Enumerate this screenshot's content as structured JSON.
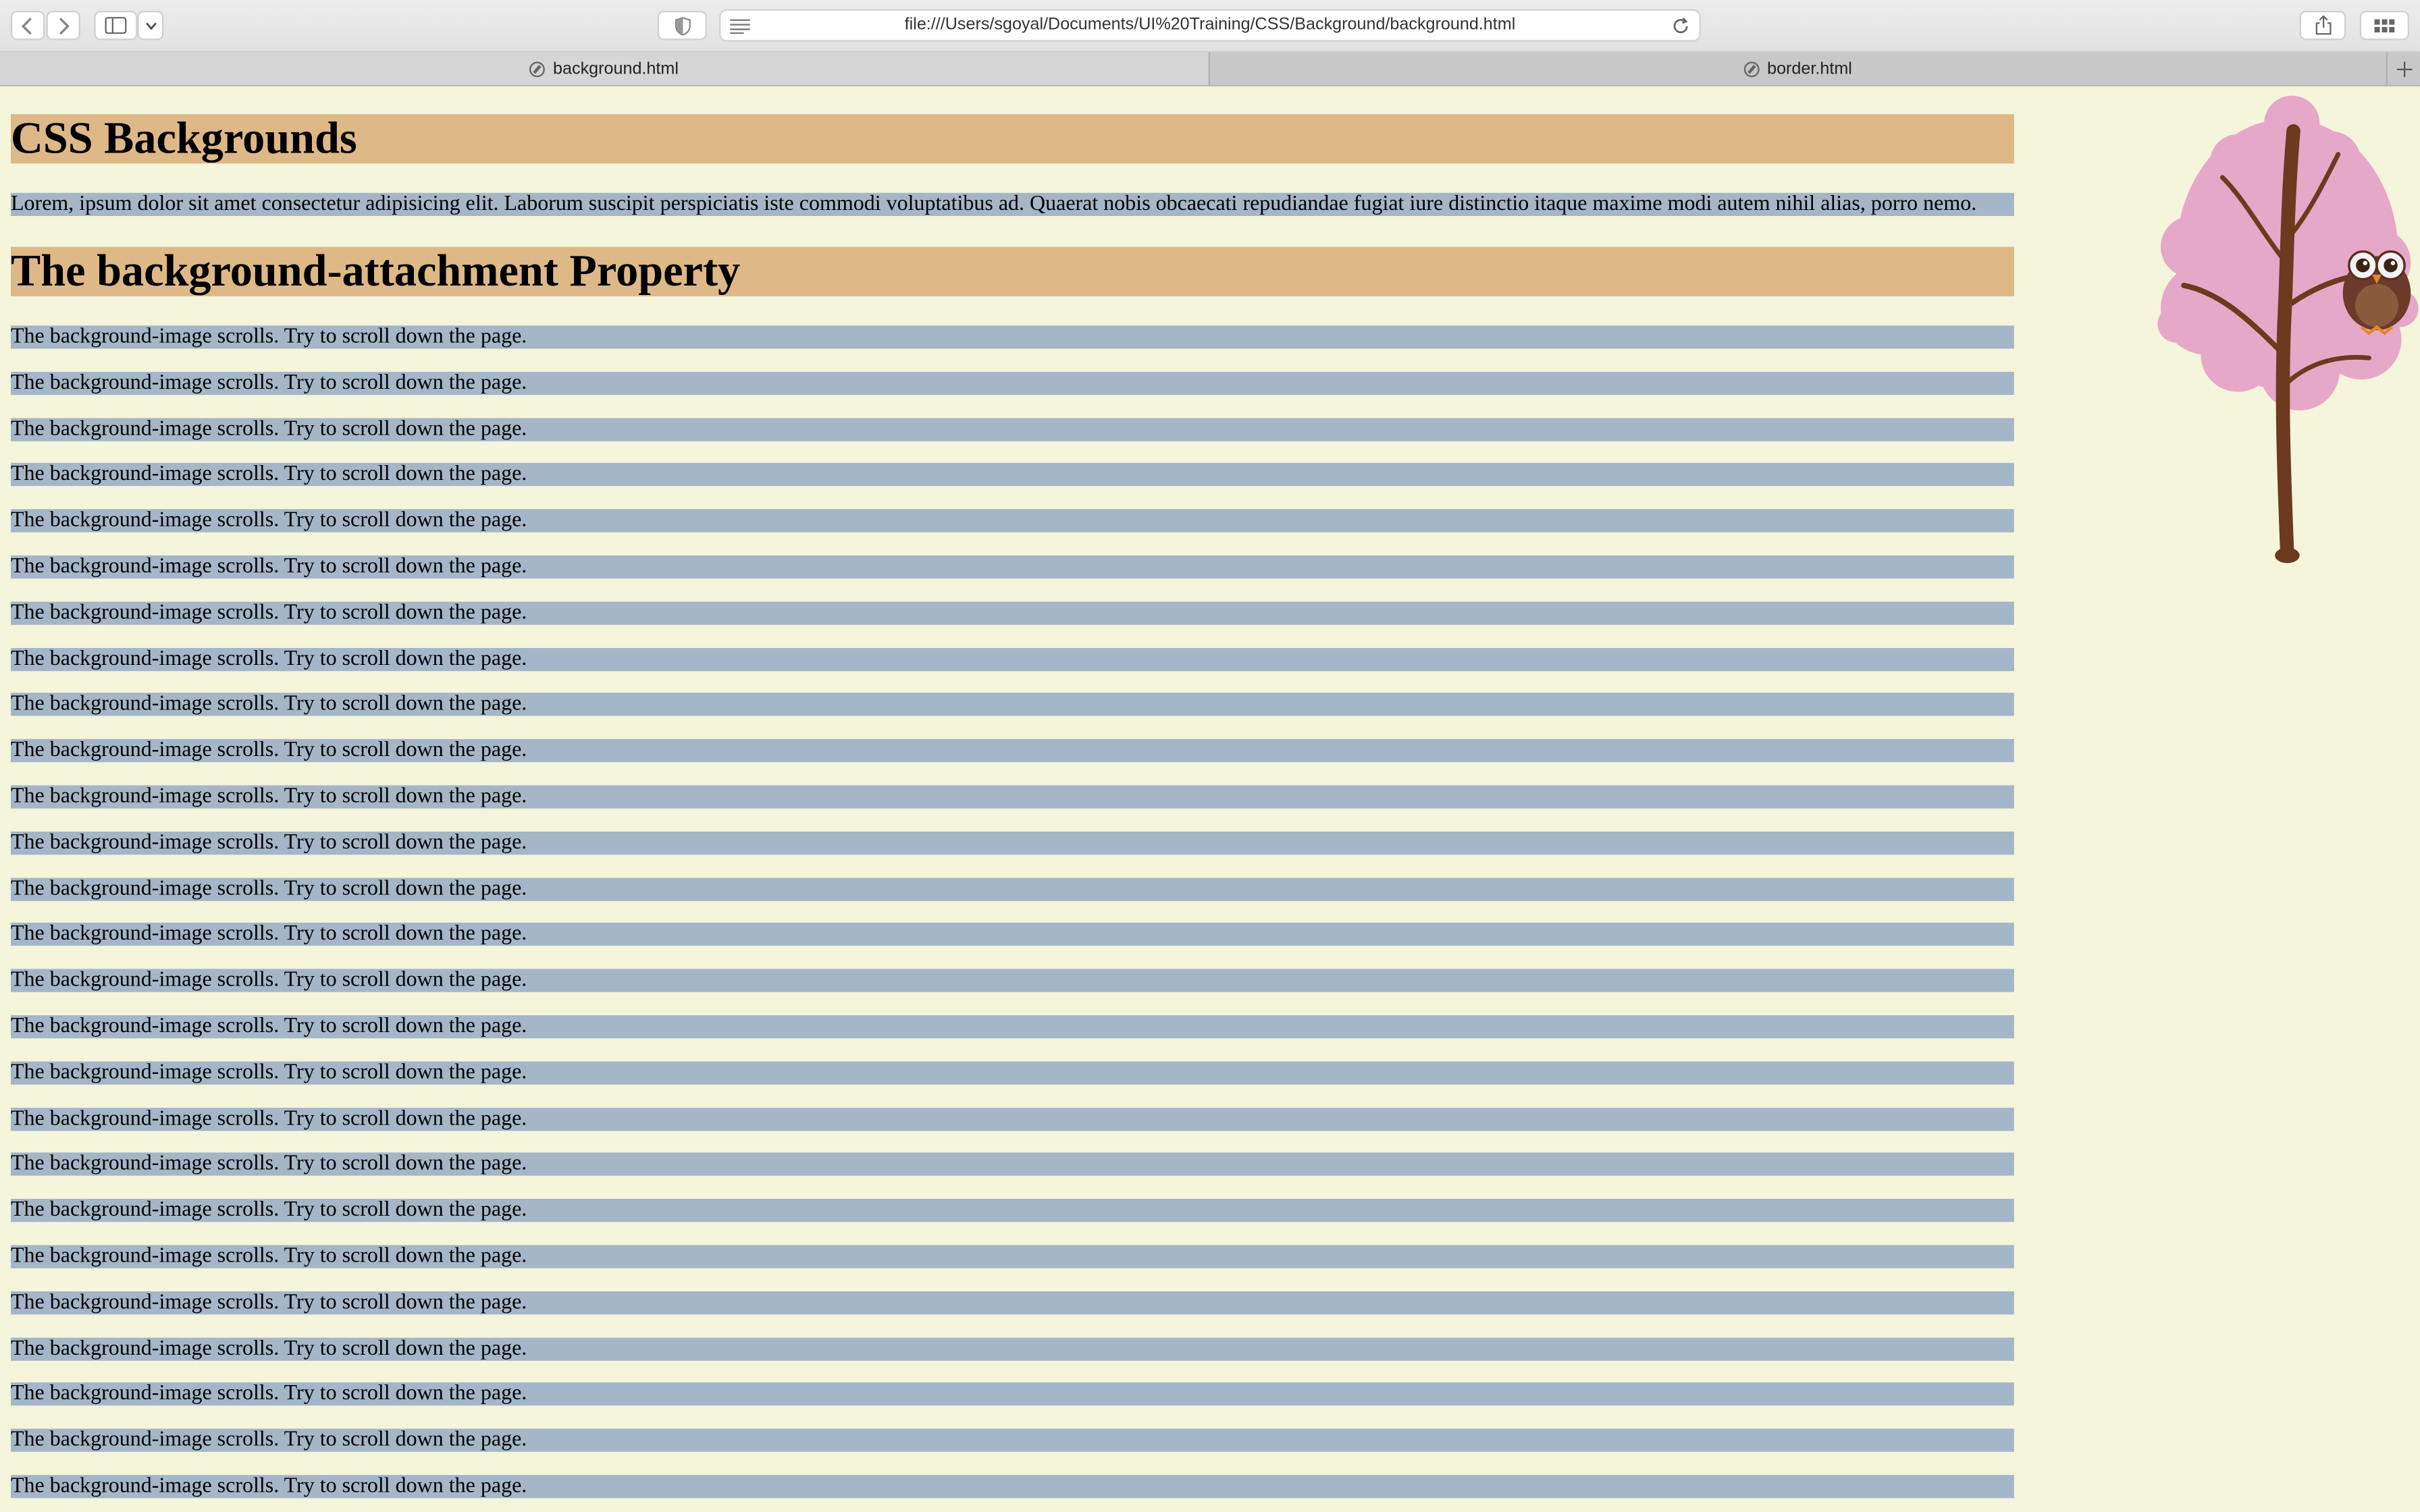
{
  "browser": {
    "url": "file:///Users/sgoyal/Documents/UI%20Training/CSS/Background/background.html",
    "tabs": [
      {
        "label": "background.html",
        "active": true
      },
      {
        "label": "border.html",
        "active": false
      }
    ]
  },
  "page": {
    "heading1": "CSS Backgrounds",
    "intro": "Lorem, ipsum dolor sit amet consectetur adipisicing elit. Laborum suscipit perspiciatis iste commodi voluptatibus ad. Quaerat nobis obcaecati repudiandae fugiat iure distinctio itaque maxime modi autem nihil alias, porro nemo.",
    "heading2": "The background-attachment Property",
    "scroll_lines": [
      "The background-image scrolls. Try to scroll down the page.",
      "The background-image scrolls. Try to scroll down the page.",
      "The background-image scrolls. Try to scroll down the page.",
      "The background-image scrolls. Try to scroll down the page.",
      "The background-image scrolls. Try to scroll down the page.",
      "The background-image scrolls. Try to scroll down the page.",
      "The background-image scrolls. Try to scroll down the page.",
      "The background-image scrolls. Try to scroll down the page.",
      "The background-image scrolls. Try to scroll down the page.",
      "The background-image scrolls. Try to scroll down the page.",
      "The background-image scrolls. Try to scroll down the page.",
      "The background-image scrolls. Try to scroll down the page.",
      "The background-image scrolls. Try to scroll down the page.",
      "The background-image scrolls. Try to scroll down the page.",
      "The background-image scrolls. Try to scroll down the page.",
      "The background-image scrolls. Try to scroll down the page.",
      "The background-image scrolls. Try to scroll down the page.",
      "The background-image scrolls. Try to scroll down the page.",
      "The background-image scrolls. Try to scroll down the page.",
      "The background-image scrolls. Try to scroll down the page.",
      "The background-image scrolls. Try to scroll down the page.",
      "The background-image scrolls. Try to scroll down the page.",
      "The background-image scrolls. Try to scroll down the page.",
      "The background-image scrolls. Try to scroll down the page.",
      "The background-image scrolls. Try to scroll down the page.",
      "The background-image scrolls. Try to scroll down the page."
    ]
  },
  "colors": {
    "page_background": "#f5f5dc",
    "heading_background": "#deb887",
    "paragraph_background": "#a4b6c7"
  },
  "icons": [
    "back-icon",
    "forward-icon",
    "sidebar-icon",
    "chevron-down-icon",
    "privacy-shield-icon",
    "reader-icon",
    "reload-icon",
    "share-icon",
    "tab-overview-icon",
    "new-tab-icon",
    "compass-icon"
  ]
}
